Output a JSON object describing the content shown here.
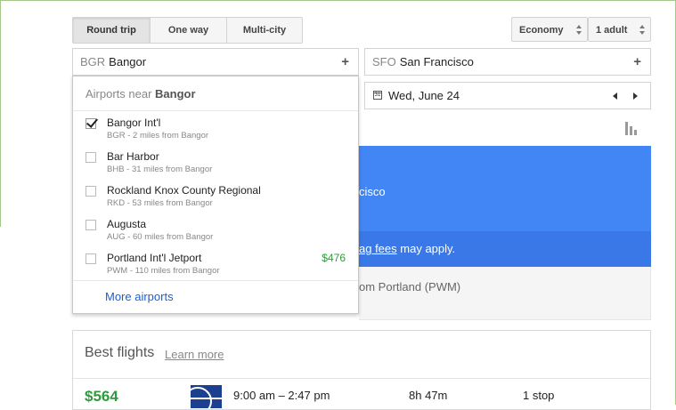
{
  "trip_types": [
    {
      "label": "Round trip",
      "active": true
    },
    {
      "label": "One way",
      "active": false
    },
    {
      "label": "Multi-city",
      "active": false
    }
  ],
  "cabin": "Economy",
  "passengers": "1 adult",
  "origin": {
    "code": "BGR",
    "city": "Bangor"
  },
  "destination": {
    "code": "SFO",
    "city": "San Francisco"
  },
  "date": {
    "calendar_day": "31",
    "value": "Wed, June 24"
  },
  "dropdown": {
    "header_prefix": "Airports near",
    "header_city": "Bangor",
    "airports": [
      {
        "name": "Bangor Int'l",
        "detail": "BGR - 2 miles from Bangor",
        "checked": true,
        "price": ""
      },
      {
        "name": "Bar Harbor",
        "detail": "BHB - 31 miles from Bangor",
        "checked": false,
        "price": ""
      },
      {
        "name": "Rockland Knox County Regional",
        "detail": "RKD - 53 miles from Bangor",
        "checked": false,
        "price": ""
      },
      {
        "name": "Augusta",
        "detail": "AUG - 60 miles from Bangor",
        "checked": false,
        "price": ""
      },
      {
        "name": "Portland Int'l Jetport",
        "detail": "PWM - 110 miles from Bangor",
        "checked": false,
        "price": "$476"
      }
    ],
    "more_link": "More airports"
  },
  "info_panel": {
    "partial_destination": "cisco",
    "bag_link": "ag fees",
    "bag_suffix": " may apply.",
    "partial_from": "om Portland (PWM)"
  },
  "best_flights": {
    "title": "Best flights",
    "learn_more": "Learn more",
    "first_result": {
      "price": "$564",
      "times": "9:00 am – 2:47 pm",
      "duration": "8h 47m",
      "stops": "1 stop"
    }
  },
  "colors": {
    "blue": "#4285f4",
    "blue_dark": "#3b78e7",
    "price_green": "#2e9a3e",
    "link": "#1a5fd4"
  }
}
